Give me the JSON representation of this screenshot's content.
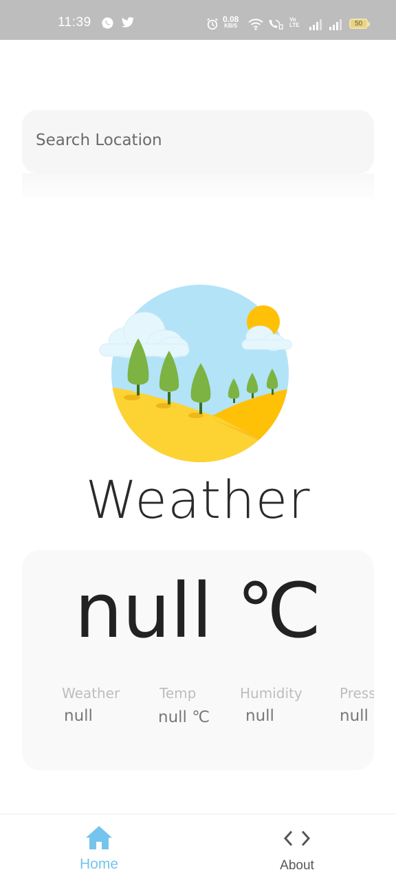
{
  "status_bar": {
    "time": "11:39",
    "net_speed": "0.08",
    "net_unit": "KB/S",
    "volte_top": "Vo",
    "volte_bottom": "LTE",
    "battery": "50"
  },
  "search": {
    "placeholder": "Search Location",
    "value": ""
  },
  "app": {
    "title": "Weather"
  },
  "current": {
    "temperature": "null ℃"
  },
  "stats": [
    {
      "label": "Weather",
      "value": "null"
    },
    {
      "label": "Temp",
      "value": "null ℃"
    },
    {
      "label": "Humidity",
      "value": "null"
    },
    {
      "label": "Press",
      "value": "null"
    }
  ],
  "nav": {
    "items": [
      {
        "label": "Home",
        "icon": "home-icon",
        "active": true
      },
      {
        "label": "About",
        "icon": "code-icon",
        "active": false
      }
    ]
  },
  "colors": {
    "accent": "#74c4ee",
    "status_bar": "#bdbdbd",
    "card_bg": "#f9f9f9"
  }
}
